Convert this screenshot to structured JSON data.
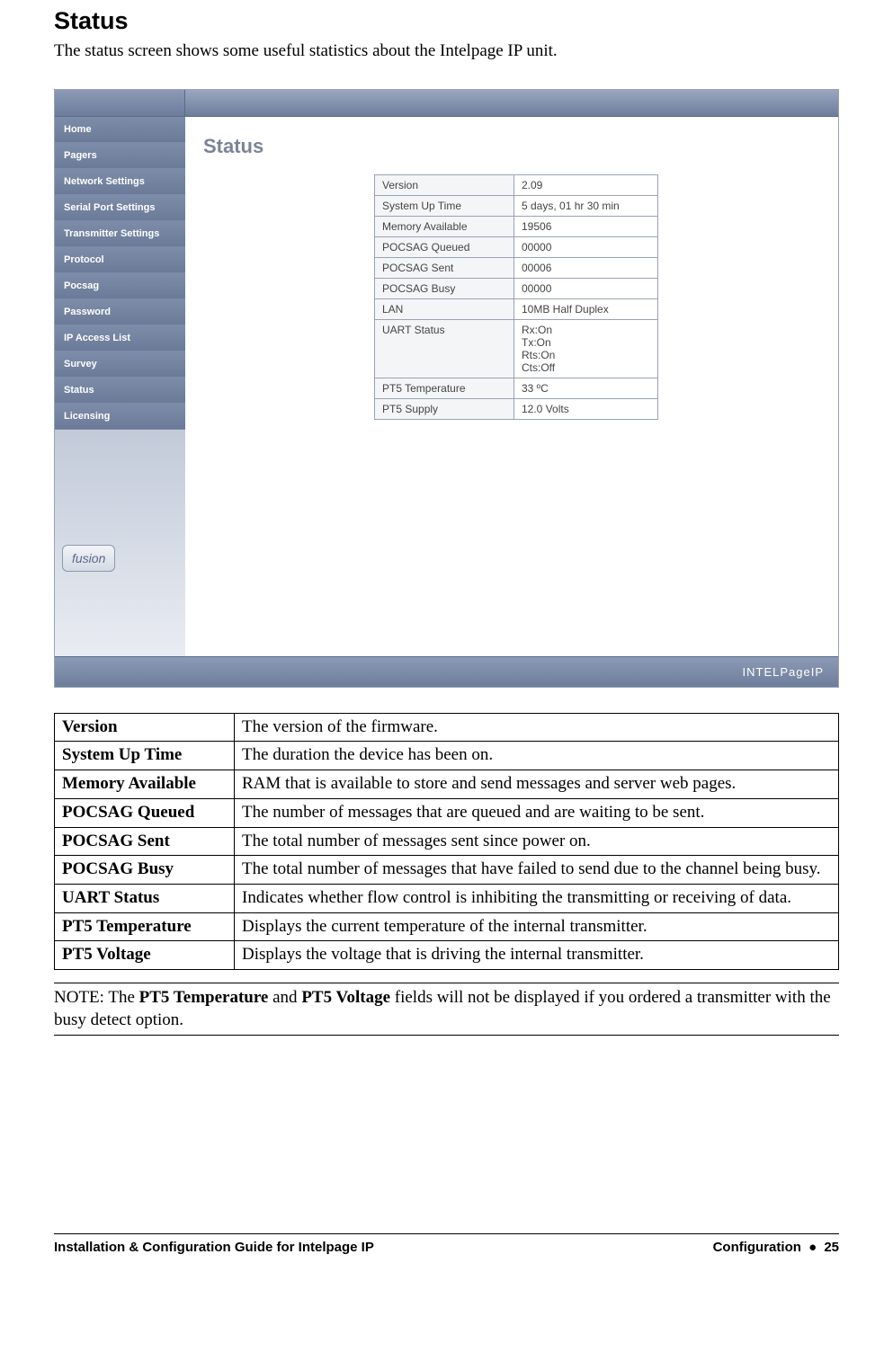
{
  "heading": "Status",
  "intro": "The status screen shows some useful statistics about the Intelpage IP unit.",
  "screenshot": {
    "nav_items": [
      "Home",
      "Pagers",
      "Network Settings",
      "Serial Port Settings",
      "Transmitter Settings",
      "Protocol",
      "Pocsag",
      "Password",
      "IP Access List",
      "Survey",
      "Status",
      "Licensing"
    ],
    "page_title": "Status",
    "rows": [
      {
        "k": "Version",
        "v": "2.09"
      },
      {
        "k": "System Up Time",
        "v": "5 days, 01 hr 30 min"
      },
      {
        "k": "Memory Available",
        "v": "19506"
      },
      {
        "k": "POCSAG Queued",
        "v": "00000"
      },
      {
        "k": "POCSAG Sent",
        "v": "00006"
      },
      {
        "k": "POCSAG Busy",
        "v": "00000"
      },
      {
        "k": "LAN",
        "v": "10MB Half Duplex"
      },
      {
        "k": "UART Status",
        "v": "Rx:On\nTx:On\nRts:On\nCts:Off"
      },
      {
        "k": "PT5 Temperature",
        "v": "33 ºC"
      },
      {
        "k": "PT5 Supply",
        "v": "12.0 Volts"
      }
    ],
    "brand_bottom": "INTELPageIP",
    "badge": "fusion"
  },
  "descriptions": [
    {
      "term": "Version",
      "desc": "The version of the firmware."
    },
    {
      "term": "System Up Time",
      "desc": "The duration the device has been on."
    },
    {
      "term": "Memory Available",
      "desc": "RAM that is available to store and send messages and server web pages."
    },
    {
      "term": "POCSAG Queued",
      "desc": "The number of messages that are queued and are waiting to be sent."
    },
    {
      "term": "POCSAG Sent",
      "desc": "The total number of messages sent since power on."
    },
    {
      "term": "POCSAG Busy",
      "desc": "The total number of messages that have failed to send due to the channel being busy."
    },
    {
      "term": "UART Status",
      "desc": "Indicates whether flow control is inhibiting the transmitting or receiving of data."
    },
    {
      "term": "PT5 Temperature",
      "desc": "Displays the current temperature of the internal transmitter."
    },
    {
      "term": "PT5 Voltage",
      "desc": "Displays the voltage that is driving the internal transmitter."
    }
  ],
  "note": {
    "prefix": "NOTE: The ",
    "b1": "PT5 Temperature",
    "mid": " and ",
    "b2": "PT5 Voltage",
    "suffix": " fields will not be displayed if you ordered a transmitter with the busy detect option."
  },
  "footer": {
    "left": "Installation & Configuration Guide for Intelpage IP",
    "right_section": "Configuration",
    "right_bullet": "●",
    "right_page": "25"
  }
}
